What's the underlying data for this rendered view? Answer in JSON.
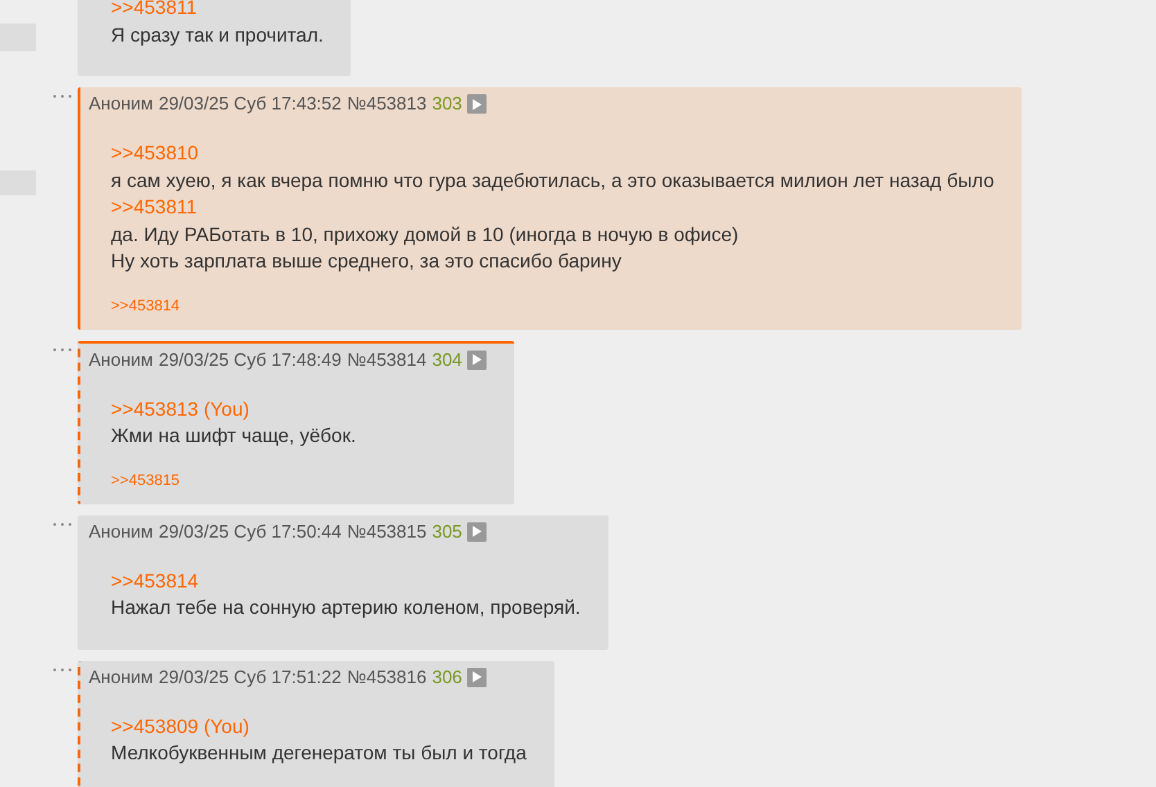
{
  "sidebar": {
    "tabs": [
      {
        "selected": false
      },
      {
        "selected": false
      }
    ]
  },
  "posts": [
    {
      "highlighted": false,
      "replies_to_you": false,
      "focused": false,
      "body": [
        {
          "kind": "link",
          "text": ">>453811"
        },
        {
          "kind": "text",
          "text": "Я сразу так и прочитал."
        }
      ]
    },
    {
      "highlighted": true,
      "replies_to_you": false,
      "focused": false,
      "header": {
        "name": "Аноним",
        "date": "29/03/25 Суб 17:43:52",
        "number": "№453813",
        "index": "303"
      },
      "body": [
        {
          "kind": "link",
          "text": ">>453810"
        },
        {
          "kind": "text",
          "text": "я сам хуею, я как вчера помню что гура задебютилась, а это оказывается милион лет назад было"
        },
        {
          "kind": "link",
          "text": ">>453811"
        },
        {
          "kind": "text",
          "text": "да. Иду РАБотать в 10, прихожу домой в 10 (иногда в ночую в офисе)"
        },
        {
          "kind": "text",
          "text": "Ну хоть зарплата выше среднего, за это спасибо барину"
        }
      ],
      "backlinks": [
        ">>453814"
      ]
    },
    {
      "highlighted": false,
      "replies_to_you": true,
      "focused": true,
      "header": {
        "name": "Аноним",
        "date": "29/03/25 Суб 17:48:49",
        "number": "№453814",
        "index": "304"
      },
      "body": [
        {
          "kind": "link",
          "text": ">>453813 (You)"
        },
        {
          "kind": "text",
          "text": "Жми на шифт чаще, уёбок."
        }
      ],
      "backlinks": [
        ">>453815"
      ]
    },
    {
      "highlighted": false,
      "replies_to_you": false,
      "focused": false,
      "header": {
        "name": "Аноним",
        "date": "29/03/25 Суб 17:50:44",
        "number": "№453815",
        "index": "305"
      },
      "body": [
        {
          "kind": "link",
          "text": ">>453814"
        },
        {
          "kind": "text",
          "text": "Нажал тебе на сонную артерию коленом, проверяй."
        }
      ]
    },
    {
      "highlighted": false,
      "replies_to_you": true,
      "focused": false,
      "header": {
        "name": "Аноним",
        "date": "29/03/25 Суб 17:51:22",
        "number": "№453816",
        "index": "306"
      },
      "body": [
        {
          "kind": "link",
          "text": ">>453809 (You)"
        },
        {
          "kind": "text",
          "text": "Мелкобуквенным дегенератом ты был и тогда"
        }
      ]
    }
  ]
}
